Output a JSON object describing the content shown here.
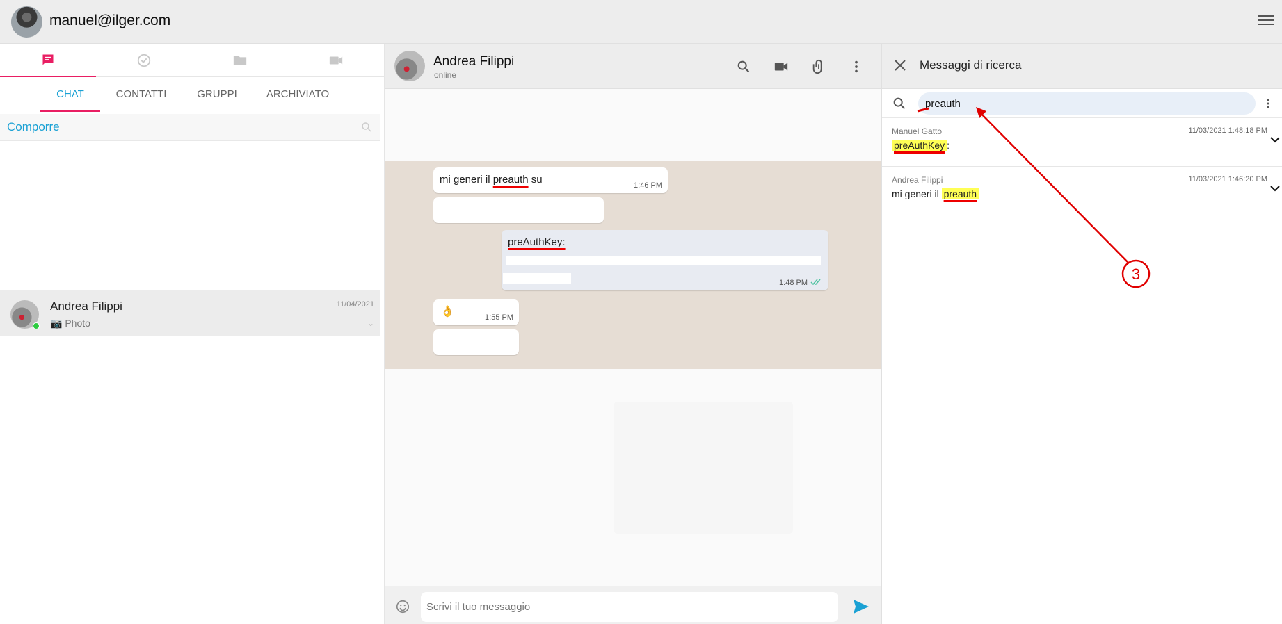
{
  "user": {
    "email": "manuel@ilger.com"
  },
  "left": {
    "icon_tabs": [
      "chat-icon",
      "check-circle-icon",
      "folder-icon",
      "video-icon"
    ],
    "tabs": [
      {
        "label": "CHAT",
        "active": true
      },
      {
        "label": "CONTATTI",
        "active": false
      },
      {
        "label": "GRUPPI",
        "active": false
      },
      {
        "label": "ARCHIVIATO",
        "active": false
      }
    ],
    "compose_label": "Comporre",
    "chat_item": {
      "name": "Andrea Filippi",
      "date": "11/04/2021",
      "last_message": "Photo",
      "online": true
    }
  },
  "chat": {
    "contact_name": "Andrea Filippi",
    "status": "online",
    "messages": [
      {
        "pre": "mi generi il ",
        "mark": "preauth",
        "post": " su",
        "time": "1:46 PM",
        "direction": "in"
      },
      {
        "text": "preAuthKey:",
        "time": "1:48 PM",
        "direction": "out"
      },
      {
        "text": "👌",
        "time": "1:55 PM",
        "direction": "in"
      }
    ],
    "input_placeholder": "Scrivi il tuo messaggio"
  },
  "search_panel": {
    "title": "Messaggi di ricerca",
    "query": "preauth",
    "results": [
      {
        "sender": "Manuel Gatto",
        "timestamp": "11/03/2021 1:48:18 PM",
        "pre": "",
        "highlight": "preAuthKey",
        "post": ":"
      },
      {
        "sender": "Andrea Filippi",
        "timestamp": "11/03/2021 1:46:20 PM",
        "pre": "mi generi il ",
        "highlight": "preauth",
        "post": ""
      }
    ]
  },
  "annotation": {
    "step": "3",
    "color": "#e00000"
  },
  "colors": {
    "accent": "#e91e63",
    "link": "#1aa1d4",
    "send": "#1aa1d4"
  }
}
